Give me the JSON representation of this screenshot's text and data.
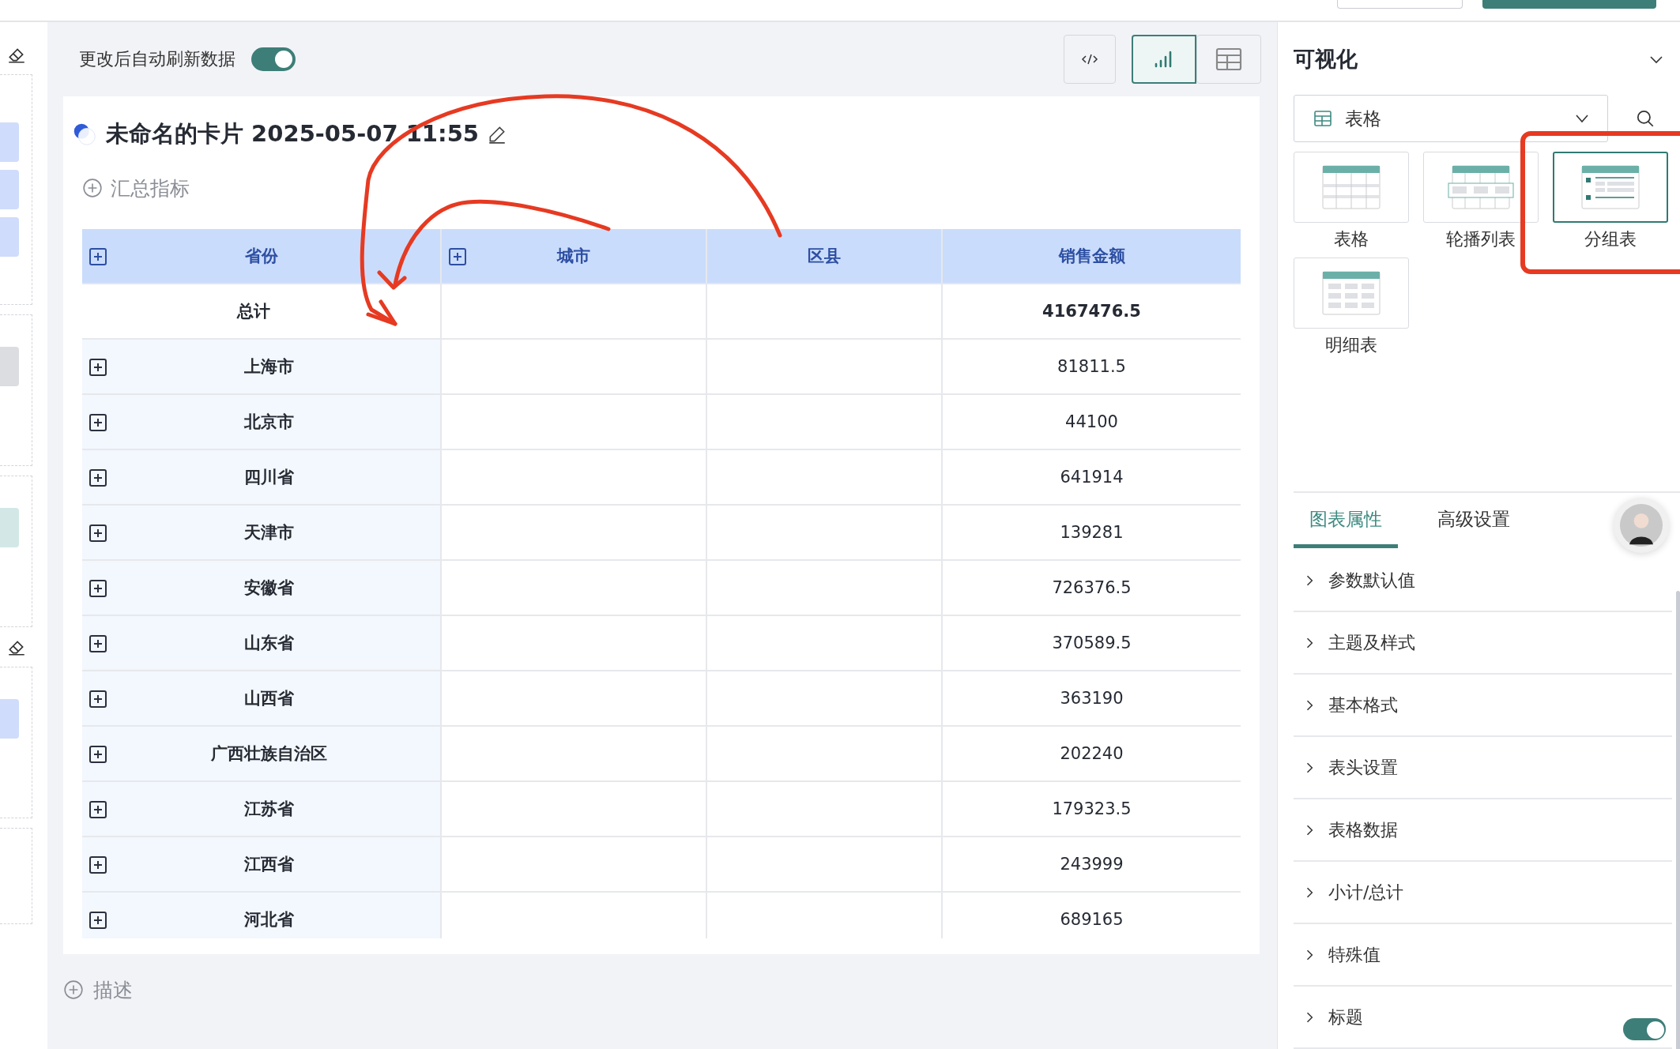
{
  "toolbar": {
    "auto_refresh_label": "更改后自动刷新数据",
    "auto_refresh_on": true,
    "view_buttons": [
      {
        "kind": "code",
        "selected": false
      },
      {
        "kind": "chart",
        "selected": true
      },
      {
        "kind": "table",
        "selected": false
      }
    ]
  },
  "card": {
    "title": "未命名的卡片 2025-05-07 11:55",
    "summary_label": "汇总指标",
    "table": {
      "columns": [
        {
          "label": "省份",
          "expandable": true
        },
        {
          "label": "城市",
          "expandable": true
        },
        {
          "label": "区县",
          "expandable": false
        },
        {
          "label": "销售金额",
          "expandable": false
        }
      ],
      "rows": [
        {
          "kind": "total",
          "label": "总计",
          "amount": "4167476.5"
        },
        {
          "kind": "group",
          "label": "上海市",
          "amount": "81811.5"
        },
        {
          "kind": "group",
          "label": "北京市",
          "amount": "44100"
        },
        {
          "kind": "group",
          "label": "四川省",
          "amount": "641914"
        },
        {
          "kind": "group",
          "label": "天津市",
          "amount": "139281"
        },
        {
          "kind": "group",
          "label": "安徽省",
          "amount": "726376.5"
        },
        {
          "kind": "group",
          "label": "山东省",
          "amount": "370589.5"
        },
        {
          "kind": "group",
          "label": "山西省",
          "amount": "363190"
        },
        {
          "kind": "group",
          "label": "广西壮族自治区",
          "amount": "202240"
        },
        {
          "kind": "group",
          "label": "江苏省",
          "amount": "179323.5"
        },
        {
          "kind": "group",
          "label": "江西省",
          "amount": "243999"
        },
        {
          "kind": "group",
          "label": "河北省",
          "amount": "689165"
        }
      ]
    }
  },
  "description_label": "描述",
  "panel": {
    "title": "可视化",
    "type_select": {
      "value": "表格"
    },
    "chart_types": [
      {
        "kind": "table",
        "label": "表格",
        "selected": false
      },
      {
        "kind": "carousel",
        "label": "轮播列表",
        "selected": false
      },
      {
        "kind": "grouped",
        "label": "分组表",
        "selected": true
      },
      {
        "kind": "detail",
        "label": "明细表",
        "selected": false
      }
    ],
    "tabs": [
      {
        "label": "图表属性",
        "selected": true
      },
      {
        "label": "高级设置",
        "selected": false
      }
    ],
    "sections": [
      {
        "label": "参数默认值",
        "expanded": false
      },
      {
        "label": "主题及样式",
        "expanded": false
      },
      {
        "label": "基本格式",
        "expanded": false
      },
      {
        "label": "表头设置",
        "expanded": false
      },
      {
        "label": "表格数据",
        "expanded": false
      },
      {
        "label": "小计/总计",
        "expanded": false
      },
      {
        "label": "特殊值",
        "expanded": false
      },
      {
        "label": "标题",
        "expanded": false,
        "toggle_on": true
      }
    ]
  }
}
